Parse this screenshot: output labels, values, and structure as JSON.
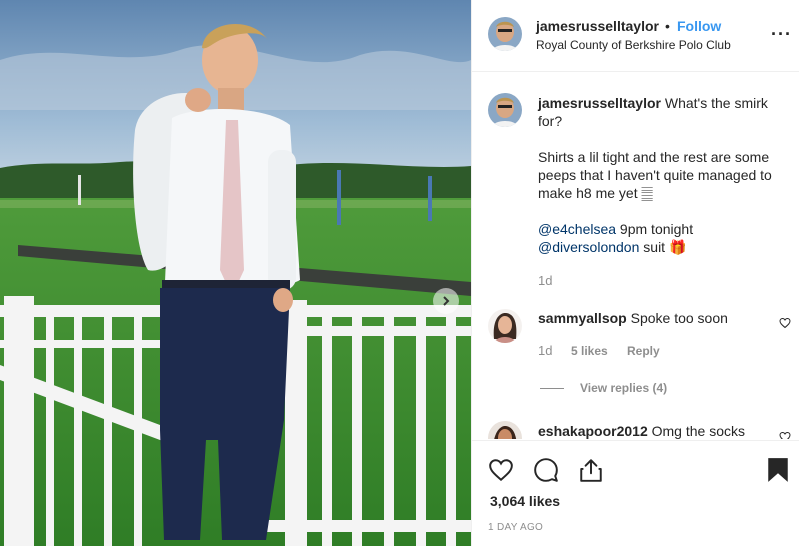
{
  "post": {
    "username": "jamesrusselltaylor",
    "separator": "•",
    "follow_label": "Follow",
    "location": "Royal County of Berkshire Polo Club",
    "more_label": "···",
    "photo_alt": "Man in white shirt and navy trousers at polo club"
  },
  "caption": {
    "username": "jamesrusselltaylor",
    "line1": "What's the smirk for?",
    "line2": "Shirts a lil tight and the rest are some peeps that I haven't quite managed to make h8 me yet 𝄛",
    "mention1": "@e4chelsea",
    "mention1_rest": " 9pm tonight",
    "mention2": "@diversolondon",
    "mention2_rest": " suit 🎁",
    "time": "1d"
  },
  "comments": [
    {
      "username": "sammyallsop",
      "text": "Spoke too soon",
      "time": "1d",
      "likes": "5 likes",
      "reply_label": "Reply",
      "view_replies": "View replies (4)"
    },
    {
      "username": "eshakapoor2012",
      "text": "Omg the socks"
    }
  ],
  "actions": {
    "likes": "3,064 likes",
    "date": "1 DAY AGO",
    "icons": [
      "heart-icon",
      "comment-icon",
      "share-icon",
      "bookmark-icon"
    ]
  },
  "colors": {
    "link": "#3897f0",
    "mention": "#003569",
    "muted": "#8e8e8e",
    "text": "#262626"
  }
}
